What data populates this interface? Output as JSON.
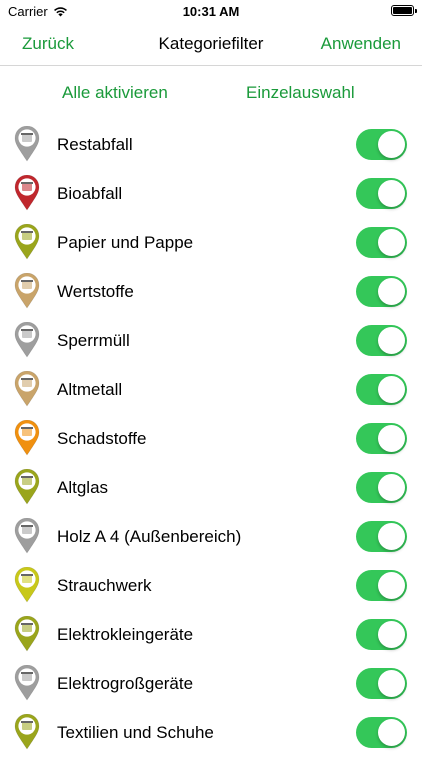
{
  "status_bar": {
    "carrier": "Carrier",
    "time": "10:31 AM"
  },
  "nav": {
    "back_label": "Zurück",
    "title": "Kategoriefilter",
    "apply_label": "Anwenden"
  },
  "actions": {
    "enable_all": "Alle aktivieren",
    "single_select": "Einzelauswahl"
  },
  "colors": {
    "accent": "#1a9a3a",
    "toggle_on": "#34c759"
  },
  "categories": [
    {
      "label": "Restabfall",
      "pin_color": "#9e9e9e",
      "icon": "residual-waste-container-icon",
      "enabled": true
    },
    {
      "label": "Bioabfall",
      "pin_color": "#c0272d",
      "icon": "organic-waste-icon",
      "enabled": true
    },
    {
      "label": "Papier und Pappe",
      "pin_color": "#9aa51c",
      "icon": "paper-container-icon",
      "enabled": true
    },
    {
      "label": "Wertstoffe",
      "pin_color": "#c9a46a",
      "icon": "recyclables-container-icon",
      "enabled": true
    },
    {
      "label": "Sperrmüll",
      "pin_color": "#9e9e9e",
      "icon": "bulky-waste-container-icon",
      "enabled": true
    },
    {
      "label": "Altmetall",
      "pin_color": "#c9a46a",
      "icon": "scrap-metal-container-icon",
      "enabled": true
    },
    {
      "label": "Schadstoffe",
      "pin_color": "#f0900f",
      "icon": "hazardous-waste-icon",
      "enabled": true
    },
    {
      "label": "Altglas",
      "pin_color": "#9aa51c",
      "icon": "glass-container-icon",
      "enabled": true
    },
    {
      "label": "Holz A 4 (Außenbereich)",
      "pin_color": "#9e9e9e",
      "icon": "wood-container-icon",
      "enabled": true
    },
    {
      "label": "Strauchwerk",
      "pin_color": "#c8c81a",
      "icon": "shrubs-leaves-icon",
      "enabled": true
    },
    {
      "label": "Elektrokleingeräte",
      "pin_color": "#9aa51c",
      "icon": "small-electronics-container-icon",
      "enabled": true
    },
    {
      "label": "Elektrogroßgeräte",
      "pin_color": "#9e9e9e",
      "icon": "large-electronics-container-icon",
      "enabled": true
    },
    {
      "label": "Textilien und Schuhe",
      "pin_color": "#9aa51c",
      "icon": "textiles-container-icon",
      "enabled": true
    }
  ]
}
